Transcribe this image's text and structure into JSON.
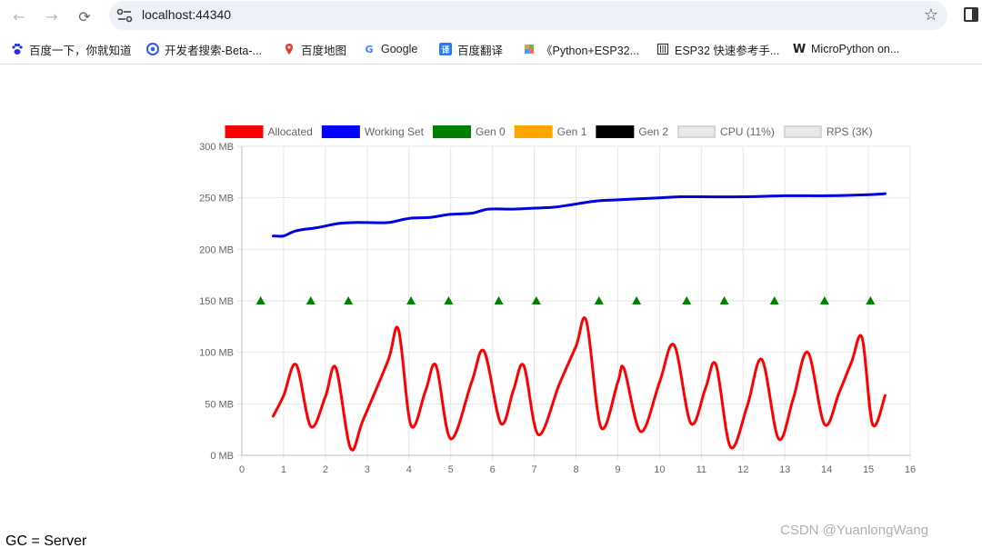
{
  "browser": {
    "url": "localhost:44340",
    "back_icon": "←",
    "forward_icon": "→",
    "reload_icon": "⟳",
    "star_icon": "☆"
  },
  "bookmarks": [
    {
      "label": "百度一下，你就知道",
      "icon": "baidu-paw-icon",
      "color": "#2932e1"
    },
    {
      "label": "开发者搜索-Beta-...",
      "icon": "dev-search-icon",
      "color": "#2f5bea"
    },
    {
      "label": "百度地图",
      "icon": "map-pin-icon",
      "color": "#e53935"
    },
    {
      "label": "Google",
      "icon": "google-icon",
      "color": "#4285f4"
    },
    {
      "label": "百度翻译",
      "icon": "translate-icon",
      "color": "#2a7cf6"
    },
    {
      "label": "《Python+ESP32...",
      "icon": "cube-icon",
      "color": "#e6a23c"
    },
    {
      "label": "ESP32 快速参考手...",
      "icon": "doc-icon",
      "color": "#333333"
    },
    {
      "label": "MicroPython on...",
      "icon": "micropython-icon",
      "color": "#000000"
    }
  ],
  "chart_data": {
    "type": "line",
    "xlim": [
      0,
      16
    ],
    "ylim": [
      0,
      300
    ],
    "x_ticks": [
      "0",
      "1",
      "2",
      "3",
      "4",
      "5",
      "6",
      "7",
      "8",
      "9",
      "10",
      "11",
      "12",
      "13",
      "14",
      "15",
      "16"
    ],
    "y_ticks": [
      "0 MB",
      "50 MB",
      "100 MB",
      "150 MB",
      "200 MB",
      "250 MB",
      "300 MB"
    ],
    "grid": true,
    "legend_position": "top",
    "legend": [
      {
        "name": "Allocated",
        "color": "#ff0000",
        "hidden": false
      },
      {
        "name": "Working Set",
        "color": "#0000ff",
        "hidden": false
      },
      {
        "name": "Gen 0",
        "color": "#008000",
        "hidden": false
      },
      {
        "name": "Gen 1",
        "color": "#ffa500",
        "hidden": false
      },
      {
        "name": "Gen 2",
        "color": "#000000",
        "hidden": false
      },
      {
        "name": "CPU (11%)",
        "color": "#e0e0e0",
        "hidden": true
      },
      {
        "name": "RPS (3K)",
        "color": "#e0e0e0",
        "hidden": true
      }
    ],
    "series": [
      {
        "name": "Working Set",
        "color": "#0000dd",
        "points": [
          [
            0.75,
            213
          ],
          [
            1.0,
            213
          ],
          [
            1.3,
            218
          ],
          [
            1.8,
            221
          ],
          [
            2.3,
            225
          ],
          [
            2.7,
            226
          ],
          [
            3.0,
            226
          ],
          [
            3.5,
            226
          ],
          [
            4.0,
            230
          ],
          [
            4.5,
            231
          ],
          [
            5.0,
            234
          ],
          [
            5.5,
            235
          ],
          [
            5.9,
            239
          ],
          [
            6.5,
            239
          ],
          [
            7.0,
            240
          ],
          [
            7.5,
            241
          ],
          [
            8.0,
            244
          ],
          [
            8.5,
            247
          ],
          [
            9.0,
            248
          ],
          [
            9.5,
            249
          ],
          [
            10.0,
            250
          ],
          [
            10.5,
            251
          ],
          [
            11.0,
            251
          ],
          [
            12.0,
            251
          ],
          [
            13.0,
            252
          ],
          [
            14.0,
            252
          ],
          [
            15.0,
            253
          ],
          [
            15.4,
            254
          ]
        ]
      },
      {
        "name": "Allocated",
        "color": "#ff0000",
        "points": [
          [
            0.75,
            38
          ],
          [
            1.0,
            58
          ],
          [
            1.3,
            88
          ],
          [
            1.65,
            28
          ],
          [
            2.0,
            57
          ],
          [
            2.25,
            85
          ],
          [
            2.6,
            7
          ],
          [
            2.9,
            34
          ],
          [
            3.5,
            92
          ],
          [
            3.75,
            122
          ],
          [
            4.05,
            29
          ],
          [
            4.4,
            63
          ],
          [
            4.65,
            87
          ],
          [
            5.0,
            16
          ],
          [
            5.5,
            71
          ],
          [
            5.8,
            101
          ],
          [
            6.2,
            31
          ],
          [
            6.5,
            63
          ],
          [
            6.75,
            87
          ],
          [
            7.1,
            20
          ],
          [
            7.6,
            69
          ],
          [
            8.0,
            106
          ],
          [
            8.25,
            130
          ],
          [
            8.6,
            27
          ],
          [
            9.0,
            71
          ],
          [
            9.15,
            84
          ],
          [
            9.55,
            23
          ],
          [
            10.0,
            71
          ],
          [
            10.35,
            107
          ],
          [
            10.75,
            31
          ],
          [
            11.1,
            65
          ],
          [
            11.35,
            88
          ],
          [
            11.7,
            8
          ],
          [
            12.1,
            48
          ],
          [
            12.45,
            93
          ],
          [
            12.85,
            16
          ],
          [
            13.2,
            55
          ],
          [
            13.55,
            100
          ],
          [
            13.95,
            30
          ],
          [
            14.3,
            61
          ],
          [
            14.6,
            91
          ],
          [
            14.85,
            114
          ],
          [
            15.1,
            30
          ],
          [
            15.4,
            58
          ]
        ]
      },
      {
        "name": "Gen 0",
        "color": "#008000",
        "marker": "triangle",
        "points": [
          [
            0.45,
            150
          ],
          [
            1.65,
            150
          ],
          [
            2.55,
            150
          ],
          [
            4.05,
            150
          ],
          [
            4.95,
            150
          ],
          [
            6.15,
            150
          ],
          [
            7.05,
            150
          ],
          [
            8.55,
            150
          ],
          [
            9.45,
            150
          ],
          [
            10.65,
            150
          ],
          [
            11.55,
            150
          ],
          [
            12.75,
            150
          ],
          [
            13.95,
            150
          ],
          [
            15.05,
            150
          ]
        ]
      }
    ]
  },
  "footer": {
    "gc_text": "GC = Server",
    "watermark": "CSDN @YuanlongWang"
  }
}
